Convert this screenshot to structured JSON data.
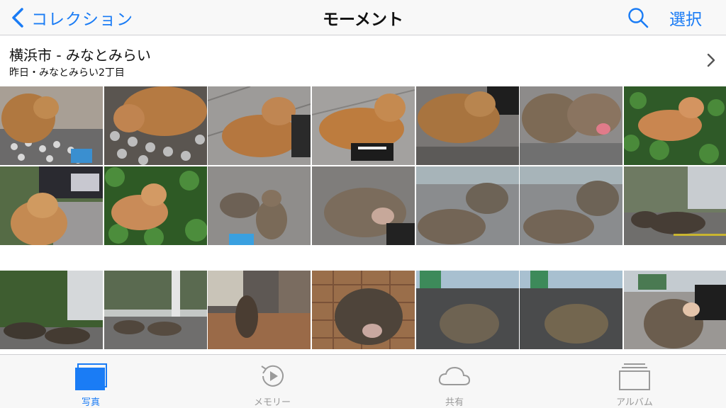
{
  "navbar": {
    "back_label": "コレクション",
    "title": "モーメント",
    "select_label": "選択",
    "accent_color": "#1a7cf5"
  },
  "moment": {
    "title": "横浜市 - みなとみらい",
    "subtitle": "昨日・みなとみらい2丁目"
  },
  "photos": {
    "rows": 3,
    "columns": 7,
    "count": 21
  },
  "tabbar": {
    "tabs": [
      {
        "label": "写真",
        "icon": "photos-icon",
        "active": true
      },
      {
        "label": "メモリー",
        "icon": "memories-icon",
        "active": false
      },
      {
        "label": "共有",
        "icon": "shared-cloud-icon",
        "active": false
      },
      {
        "label": "アルバム",
        "icon": "albums-icon",
        "active": false
      }
    ]
  }
}
